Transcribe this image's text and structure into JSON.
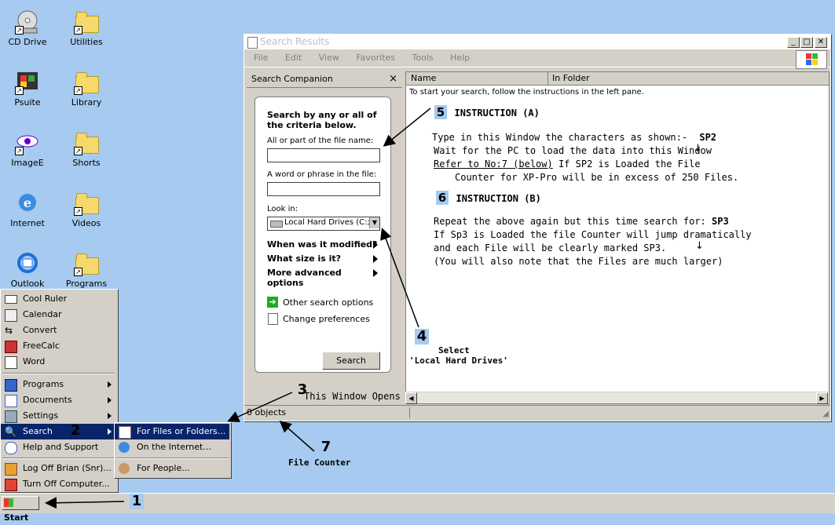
{
  "desktop": {
    "icons": [
      {
        "label": "CD Drive"
      },
      {
        "label": "Utilities"
      },
      {
        "label": "Psuite"
      },
      {
        "label": "Library"
      },
      {
        "label": "ImageE"
      },
      {
        "label": "Shorts"
      },
      {
        "label": "Internet"
      },
      {
        "label": "Videos"
      },
      {
        "label": "Outlook"
      },
      {
        "label": "Programs"
      }
    ]
  },
  "window": {
    "title": "Search Results",
    "menu": [
      "File",
      "Edit",
      "View",
      "Favorites",
      "Tools",
      "Help"
    ],
    "companion": {
      "header": "Search Companion",
      "close": "×",
      "heading": "Search by any or all of the criteria below.",
      "filename_label": "All or part of the file name:",
      "phrase_label": "A word or phrase in the file:",
      "lookin_label": "Look in:",
      "lookin_value": "Local Hard Drives (C:;",
      "modified": "When was it modified?",
      "size": "What size is it?",
      "advanced": "More advanced options",
      "other_options": "Other search options",
      "change_prefs": "Change preferences",
      "search_button": "Search"
    },
    "results": {
      "col_name": "Name",
      "col_folder": "In Folder",
      "hint": "To start your search, follow the instructions in the left pane.",
      "instr_a_num": "5",
      "instr_a_title": "INSTRUCTION (A)",
      "instr_a_lines": [
        "Type in this Window the characters as shown:-",
        "Wait for the PC to load the data into this Window",
        "Refer to No:7 (below)",
        " If SP2 is Loaded the File",
        "Counter for XP-Pro will be in excess of 250 Files."
      ],
      "instr_a_code": "SP2",
      "instr_b_num": "6",
      "instr_b_title": "INSTRUCTION (B)",
      "instr_b_lines": [
        "Repeat the above again but this time search for:",
        "If Sp3 is Loaded the file Counter will jump dramatically",
        "and each File will be clearly marked SP3.",
        "(You will also note that the Files are much larger)"
      ],
      "instr_b_code": "SP3"
    },
    "status": "0 objects",
    "opens_note": "This Window Opens"
  },
  "start_menu": {
    "top_items": [
      "Cool Ruler",
      "Calendar",
      "Convert",
      "FreeCalc",
      "Word"
    ],
    "items": [
      "Programs",
      "Documents",
      "Settings",
      "Search",
      "Help and Support"
    ],
    "bottom_items": [
      "Log Off Brian (Snr)...",
      "Turn Off Computer..."
    ],
    "search_sub": [
      "For Files or Folders...",
      "On the Internet...",
      "For People..."
    ]
  },
  "taskbar": {
    "start": "Start"
  },
  "callouts": {
    "n1": "1",
    "n2": "2",
    "n3": "3",
    "n4": "4",
    "n7": "7",
    "select": "Select",
    "select_target": "'Local Hard Drives'",
    "file_counter": "File Counter"
  },
  "colors": {
    "desktop": "#a6caf0",
    "highlight": "#0a246a",
    "chrome": "#d4d0c8"
  }
}
